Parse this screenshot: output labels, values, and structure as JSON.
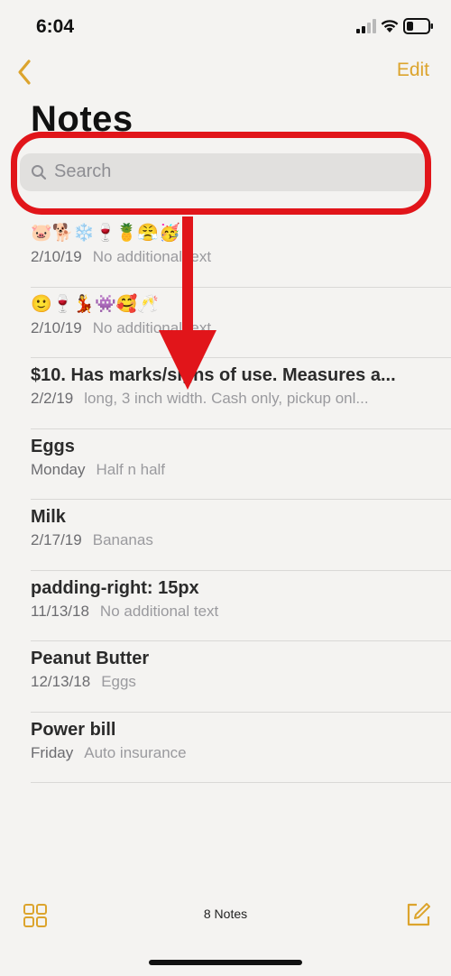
{
  "status_bar": {
    "time": "6:04"
  },
  "nav": {
    "back_icon": "chevron-left-icon",
    "edit_label": "Edit"
  },
  "page_title": "Notes",
  "search": {
    "placeholder": "Search"
  },
  "notes": [
    {
      "title": "🐷🐕❄️🍷🍍😤🥳",
      "date": "2/10/19",
      "preview": "No additional text"
    },
    {
      "title": "🙂🍷💃👾🥰🥂",
      "date": "2/10/19",
      "preview": "No additional text"
    },
    {
      "title": "$10. Has marks/signs of use. Measures a...",
      "date": "2/2/19",
      "preview": "long, 3 inch width. Cash only, pickup onl..."
    },
    {
      "title": "Eggs",
      "date": "Monday",
      "preview": "Half n half"
    },
    {
      "title": "Milk",
      "date": "2/17/19",
      "preview": "Bananas"
    },
    {
      "title": "padding-right: 15px",
      "date": "11/13/18",
      "preview": "No additional text"
    },
    {
      "title": "Peanut Butter",
      "date": "12/13/18",
      "preview": "Eggs"
    },
    {
      "title": "Power bill",
      "date": "Friday",
      "preview": "Auto insurance"
    }
  ],
  "toolbar": {
    "gallery_icon": "grid-view-icon",
    "notes_count": "8 Notes",
    "compose_icon": "compose-icon"
  },
  "colors": {
    "accent": "#dca42d",
    "annotation": "#e1151a",
    "background": "#f4f3f1"
  }
}
